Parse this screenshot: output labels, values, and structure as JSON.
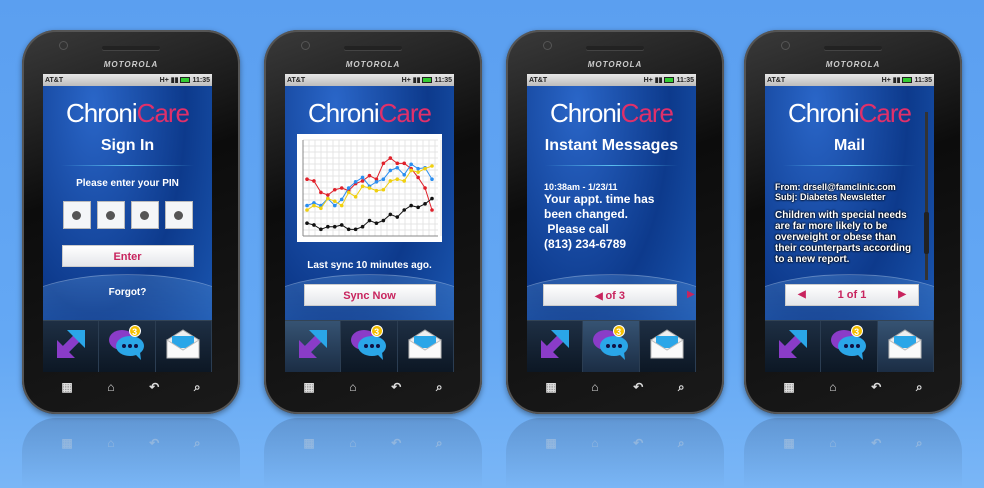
{
  "device": {
    "brand": "MOTOROLA",
    "carrier": "AT&T",
    "network": "H+",
    "time": "11:35"
  },
  "app": {
    "name_part1": "Chroni",
    "name_part2": "Care",
    "brand_color": "#e0306a"
  },
  "dock": [
    {
      "icon": "sync-arrows-icon"
    },
    {
      "icon": "chat-bubbles-icon",
      "badge": "3"
    },
    {
      "icon": "mail-envelope-icon"
    }
  ],
  "nav_keys": [
    {
      "icon": "menu-grid-icon",
      "glyph": "▦"
    },
    {
      "icon": "home-icon",
      "glyph": "⌂"
    },
    {
      "icon": "back-icon",
      "glyph": "↶"
    },
    {
      "icon": "search-icon",
      "glyph": "⌕"
    }
  ],
  "screens": {
    "signin": {
      "title": "Sign In",
      "prompt": "Please enter your PIN",
      "pin_digits_entered": 4,
      "enter_label": "Enter",
      "forgot_label": "Forgot?"
    },
    "sync": {
      "status": "Last sync 10 minutes ago.",
      "sync_label": "Sync Now"
    },
    "messages": {
      "title": "Instant Messages",
      "timestamp": "10:38am - 1/23/11",
      "line1": "Your appt. time has",
      "line2": "been changed.",
      "line3": " Please call",
      "line4": "(813) 234-6789",
      "pager": "of 3"
    },
    "mail": {
      "title": "Mail",
      "from": "From: drsell@famclinic.com",
      "subject": "Subj: Diabetes Newsletter",
      "body": "Children with special needs are far more likely to be overweight or obese than their counterparts according to a new report.",
      "pager": "1 of 1"
    }
  },
  "chart_data": {
    "type": "line",
    "grid": true,
    "ylim": [
      0,
      100
    ],
    "series": [
      {
        "color": "#e0202a",
        "values": [
          60,
          58,
          45,
          42,
          48,
          50,
          47,
          55,
          58,
          64,
          60,
          78,
          84,
          78,
          78,
          72,
          62,
          50,
          25
        ]
      },
      {
        "color": "#2a8ef0",
        "values": [
          30,
          33,
          30,
          38,
          30,
          37,
          50,
          57,
          62,
          52,
          57,
          60,
          70,
          73,
          65,
          77,
          72,
          73,
          60
        ]
      },
      {
        "color": "#f0d010",
        "values": [
          25,
          30,
          27,
          38,
          35,
          30,
          45,
          40,
          52,
          50,
          47,
          48,
          58,
          60,
          58,
          70,
          68,
          72,
          75
        ]
      },
      {
        "color": "#111111",
        "values": [
          10,
          8,
          3,
          6,
          6,
          8,
          3,
          3,
          6,
          13,
          10,
          13,
          20,
          17,
          25,
          30,
          28,
          32,
          38
        ]
      }
    ]
  }
}
